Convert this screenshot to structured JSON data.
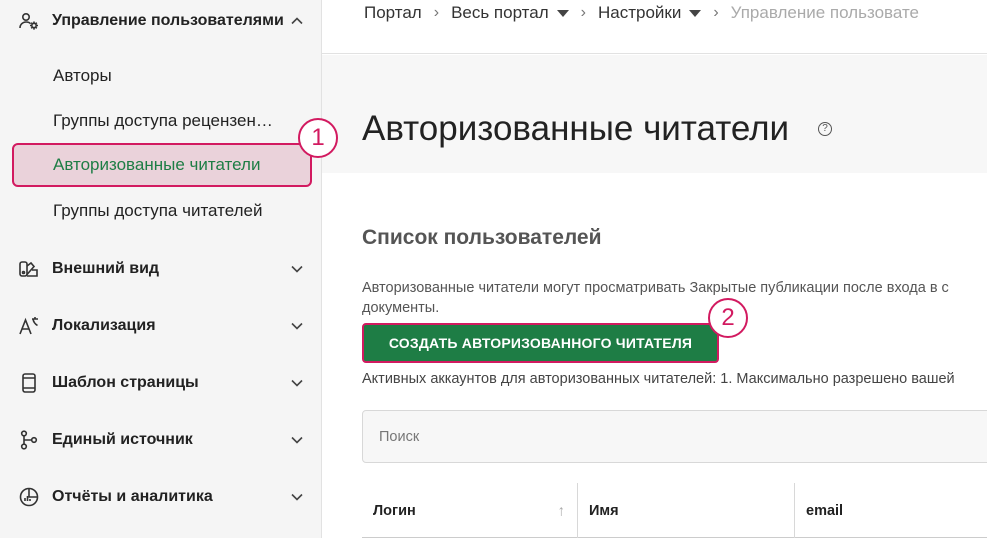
{
  "sidebar": {
    "groups": [
      {
        "label": "Управление пользователями",
        "icon": "users-gear-icon",
        "expanded": true
      },
      {
        "label": "Внешний вид",
        "icon": "palette-icon"
      },
      {
        "label": "Локализация",
        "icon": "translate-icon"
      },
      {
        "label": "Шаблон страницы",
        "icon": "page-template-icon"
      },
      {
        "label": "Единый источник",
        "icon": "single-source-icon"
      },
      {
        "label": "Отчёты и аналитика",
        "icon": "analytics-icon"
      }
    ],
    "subitems": [
      {
        "label": "Авторы"
      },
      {
        "label": "Группы доступа рецензен…"
      },
      {
        "label": "Авторизованные читатели",
        "active": true
      },
      {
        "label": "Группы доступа читателей"
      }
    ]
  },
  "annotations": [
    "1",
    "2"
  ],
  "breadcrumbs": {
    "portal": "Портал",
    "whole_portal": "Весь портал",
    "settings": "Настройки",
    "current": "Управление пользовате"
  },
  "page": {
    "title": "Авторизованные читатели",
    "section_title": "Список пользователей",
    "desc_line1": "Авторизованные читатели могут просматривать Закрытые публикации после входа в с",
    "desc_line2": "документы.",
    "create_button": "СОЗДАТЬ АВТОРИЗОВАННОГО ЧИТАТЕЛЯ",
    "active_info": "Активных аккаунтов для авторизованных читателей: 1. Максимально разрешено вашей",
    "search_placeholder": "Поиск",
    "help_symbol": "?"
  },
  "table": {
    "columns": [
      "Логин",
      "Имя",
      "email"
    ],
    "sort_symbol": "↑"
  },
  "colors": {
    "accent_green": "#1e7d45",
    "highlight_pink": "#d21a60",
    "active_bg": "#ead2da"
  }
}
